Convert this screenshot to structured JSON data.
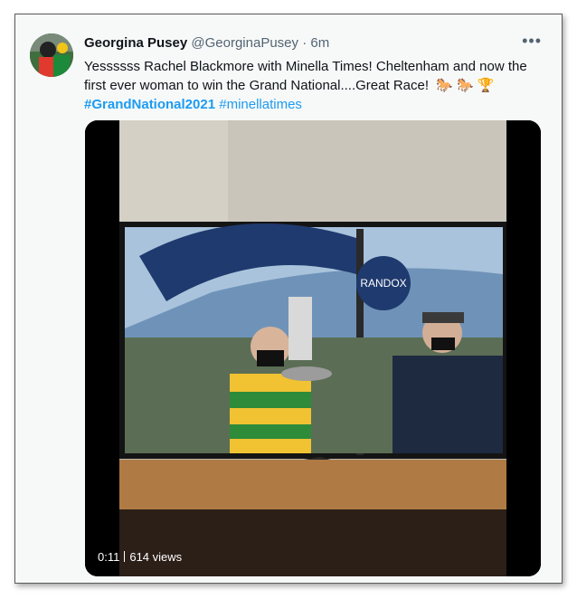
{
  "tweet": {
    "author_name": "Georgina Pusey",
    "handle": "@GeorginaPusey",
    "dot": "·",
    "time": "6m",
    "more_label": "•••",
    "text": "Yessssss Rachel Blackmore with Minella Times! Cheltenham and now the first ever woman to win the Grand National....Great Race!",
    "emoji": "🐎 🐎  🏆",
    "hashtags": [
      "#GrandNational2021",
      "#minellatimes"
    ]
  },
  "video": {
    "duration": "0:11",
    "views": "614 views",
    "tv_overlay_text": [
      "RA",
      "DOX",
      "RANDOX"
    ]
  },
  "colors": {
    "link": "#1d9bf0",
    "secondary_text": "#536471",
    "primary_text": "#0f1419"
  }
}
